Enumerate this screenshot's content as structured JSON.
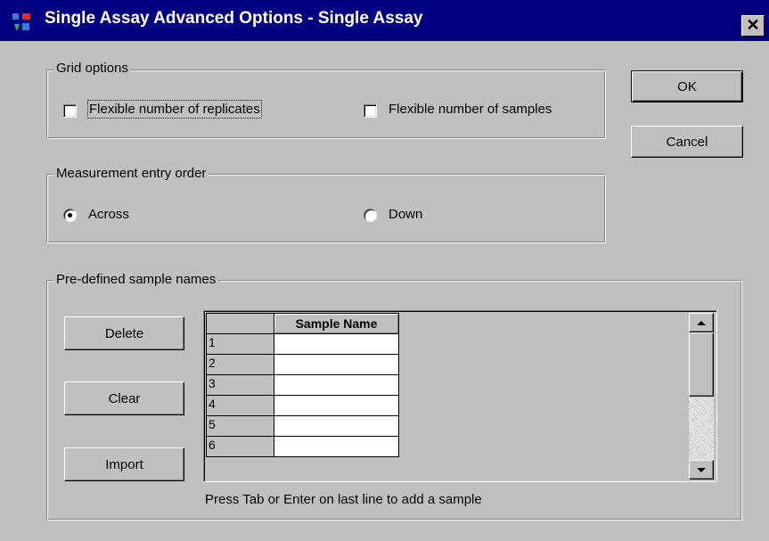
{
  "window": {
    "title": "Single Assay Advanced Options - Single Assay",
    "close_glyph": "✕",
    "titlebar_color": "#000080",
    "face_color": "#c0c0c0"
  },
  "buttons": {
    "ok": "OK",
    "cancel": "Cancel",
    "delete": "Delete",
    "clear": "Clear",
    "import": "Import"
  },
  "grid_options": {
    "label": "Grid options",
    "flexible_replicates": {
      "label": "Flexible number of replicates",
      "checked": false
    },
    "flexible_samples": {
      "label": "Flexible number of samples",
      "checked": false
    }
  },
  "measurement_order": {
    "label": "Measurement entry order",
    "across": {
      "label": "Across",
      "selected": true
    },
    "down": {
      "label": "Down",
      "selected": false
    }
  },
  "sample_names": {
    "label": "Pre-defined sample names",
    "column_header": "Sample Name",
    "rows": [
      {
        "num": "1",
        "name": ""
      },
      {
        "num": "2",
        "name": ""
      },
      {
        "num": "3",
        "name": ""
      },
      {
        "num": "4",
        "name": ""
      },
      {
        "num": "5",
        "name": ""
      },
      {
        "num": "6",
        "name": ""
      }
    ],
    "hint": "Press Tab or Enter on last line to add a sample"
  },
  "icons": {
    "app": "app-icon",
    "close": "close-icon",
    "scroll_up": "scroll-up-arrow-icon",
    "scroll_down": "scroll-down-arrow-icon"
  }
}
